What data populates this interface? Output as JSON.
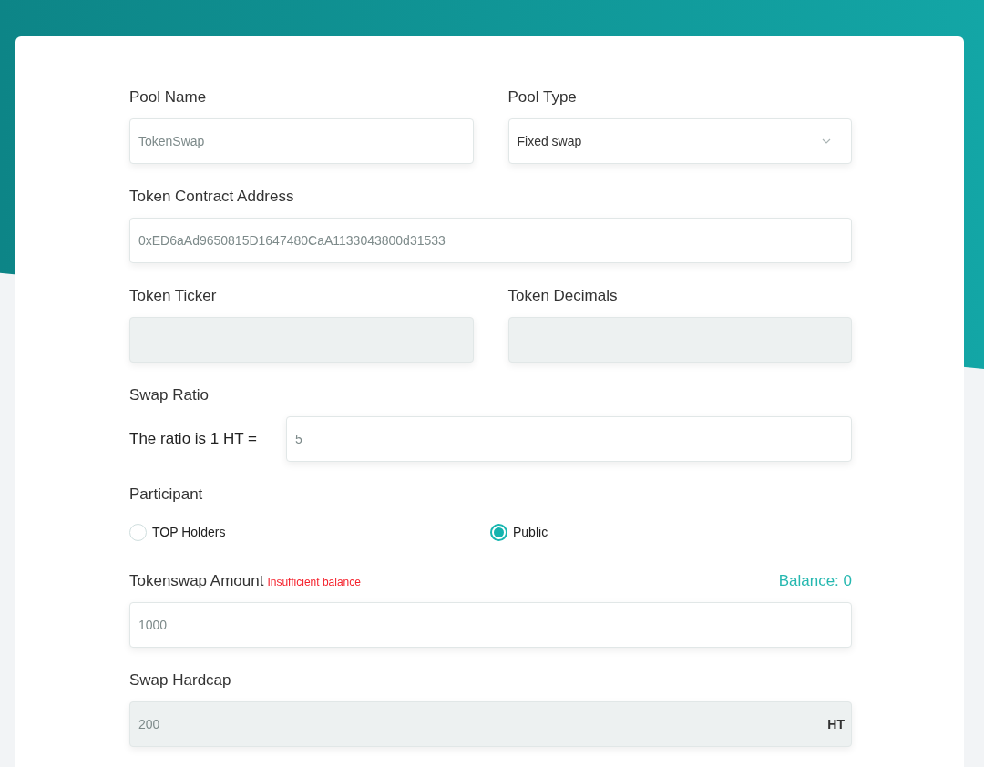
{
  "pool_name": {
    "label": "Pool Name",
    "placeholder": "TokenSwap"
  },
  "pool_type": {
    "label": "Pool Type",
    "value": "Fixed swap"
  },
  "token_contract_address": {
    "label": "Token Contract Address",
    "placeholder": "0xED6aAd9650815D1647480CaA1133043800d31533"
  },
  "token_ticker": {
    "label": "Token Ticker",
    "disabled": true
  },
  "token_decimals": {
    "label": "Token Decimals",
    "disabled": true
  },
  "swap_ratio": {
    "label": "Swap Ratio",
    "prefix": "The ratio is 1 HT =",
    "placeholder": "5"
  },
  "participant": {
    "label": "Participant",
    "options": [
      {
        "label": "TOP Holders",
        "selected": false
      },
      {
        "label": "Public",
        "selected": true
      }
    ]
  },
  "tokenswap_amount": {
    "label": "Tokenswap Amount",
    "error": "Insufficient balance",
    "balance": "Balance: 0",
    "placeholder": "1000"
  },
  "swap_hardcap": {
    "label": "Swap Hardcap",
    "placeholder": "200",
    "suffix": "HT",
    "disabled": true
  }
}
